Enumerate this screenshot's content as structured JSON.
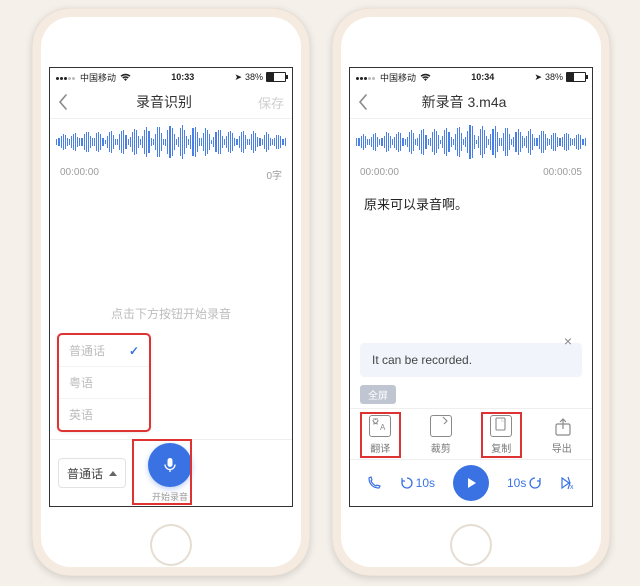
{
  "status": {
    "carrier": "中国移动",
    "wifi": "⚪",
    "battery_text": "38%",
    "time_left": "10:33",
    "time_right": "10:34"
  },
  "left": {
    "nav": {
      "title": "录音识别",
      "save": "保存"
    },
    "time_start": "00:00:00",
    "char_count": "0字",
    "placeholder": "点击下方按钮开始录音",
    "languages": {
      "opt1": "普通话",
      "opt2": "粤语",
      "opt3": "英语"
    },
    "selected_language": "普通话",
    "record_label": "开始录音"
  },
  "right": {
    "nav": {
      "title": "新录音 3.m4a"
    },
    "time_start": "00:00:00",
    "time_end": "00:00:05",
    "transcript": "原来可以录音啊。",
    "translation": "It can be recorded.",
    "full_screen_chip": "全屏",
    "actions": {
      "translate": "翻译",
      "trim": "裁剪",
      "copy": "复制",
      "export": "导出"
    },
    "skip_back": "10s",
    "skip_fwd": "10s"
  }
}
